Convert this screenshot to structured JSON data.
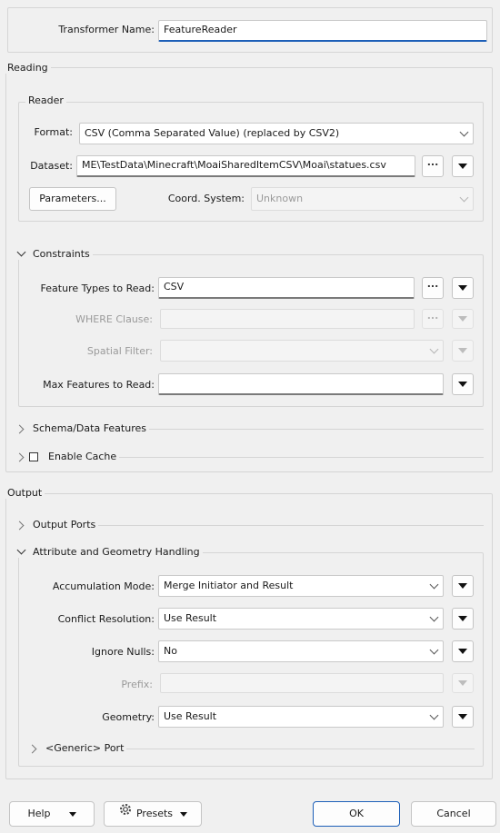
{
  "transformer": {
    "name_label": "Transformer Name:",
    "name_value": "FeatureReader"
  },
  "reading": {
    "title": "Reading",
    "reader": {
      "title": "Reader",
      "format_label": "Format:",
      "format_value": "CSV (Comma Separated Value) (replaced by CSV2)",
      "dataset_label": "Dataset:",
      "dataset_value": "ME\\TestData\\Minecraft\\MoaiSharedItemCSV\\Moai\\statues.csv",
      "browse_label": "...",
      "parameters_label": "Parameters...",
      "coord_label": "Coord. System:",
      "coord_value": "Unknown"
    },
    "constraints": {
      "title": "Constraints",
      "feature_types_label": "Feature Types to Read:",
      "feature_types_value": "CSV",
      "where_label": "WHERE Clause:",
      "where_value": "",
      "spatial_label": "Spatial Filter:",
      "spatial_value": "",
      "max_label": "Max Features to Read:",
      "max_value": "",
      "browse_label": "..."
    },
    "schema_title": "Schema/Data Features",
    "cache_title": "Enable Cache"
  },
  "output": {
    "title": "Output",
    "ports_title": "Output Ports",
    "attr_title": "Attribute and Geometry Handling",
    "accumulation_label": "Accumulation Mode:",
    "accumulation_value": "Merge Initiator and Result",
    "conflict_label": "Conflict Resolution:",
    "conflict_value": "Use Result",
    "nulls_label": "Ignore Nulls:",
    "nulls_value": "No",
    "prefix_label": "Prefix:",
    "prefix_value": "",
    "geometry_label": "Geometry:",
    "geometry_value": "Use Result",
    "generic_title": "<Generic> Port"
  },
  "footer": {
    "help": "Help",
    "presets": "Presets",
    "ok": "OK",
    "cancel": "Cancel"
  },
  "icons": [
    "chevron-down-icon",
    "chevron-right-icon",
    "dropdown-triangle-icon",
    "presets-gear-icon",
    "checkbox-icon"
  ]
}
